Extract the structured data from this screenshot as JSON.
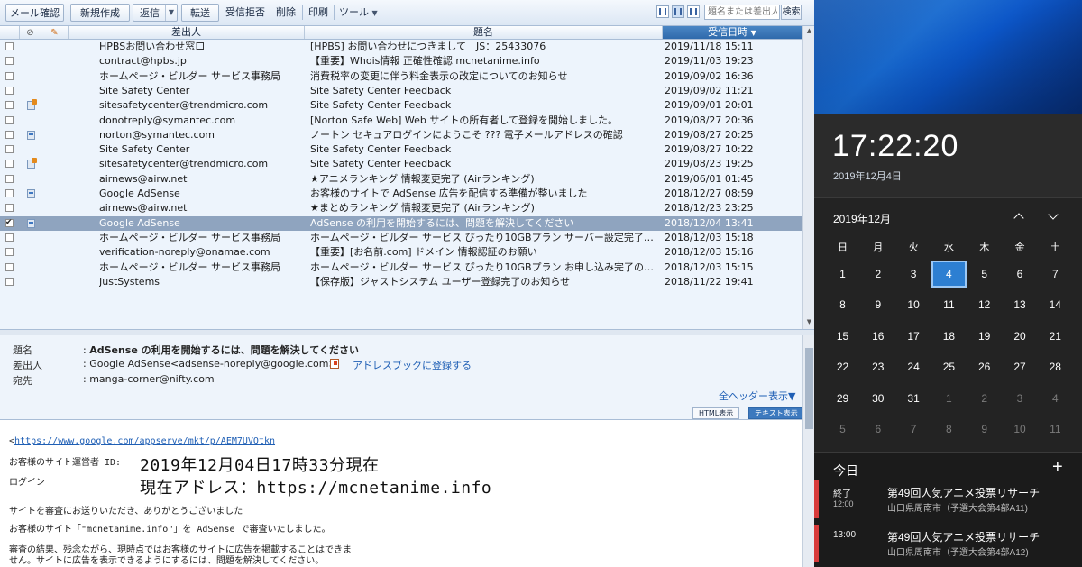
{
  "toolbar": {
    "check_mail": "メール確認",
    "new_mail": "新規作成",
    "reply": "返信",
    "forward": "転送",
    "reject": "受信拒否",
    "delete": "削除",
    "print": "印刷",
    "tools": "ツール",
    "search_placeholder": "題名または差出人",
    "search_button": "検索"
  },
  "columns": {
    "from": "差出人",
    "subject": "題名",
    "date": "受信日時"
  },
  "mails": [
    {
      "from": "HPBSお問い合わせ窓口",
      "subject": "[HPBS] お問い合わせにつきまして　JS：25433076",
      "date": "2019/11/18 15:11",
      "icon": ""
    },
    {
      "from": "contract@hpbs.jp",
      "subject": "【重要】Whois情報 正確性確認 mcnetanime.info",
      "date": "2019/11/03 19:23",
      "icon": ""
    },
    {
      "from": "ホームページ・ビルダー サービス事務局",
      "subject": "消費税率の変更に伴う料金表示の改定についてのお知らせ",
      "date": "2019/09/02 16:36",
      "icon": ""
    },
    {
      "from": "Site Safety Center",
      "subject": "Site Safety Center Feedback",
      "date": "2019/09/02 11:21",
      "icon": ""
    },
    {
      "from": "sitesafetycenter@trendmicro.com",
      "subject": "Site Safety Center Feedback",
      "date": "2019/09/01 20:01",
      "icon": "ok"
    },
    {
      "from": "donotreply@symantec.com",
      "subject": "[Norton Safe Web] Web サイトの所有者して登録を開始しました。",
      "date": "2019/08/27 20:36",
      "icon": ""
    },
    {
      "from": "norton@symantec.com",
      "subject": "ノートン セキュアログインにようこそ ??? 電子メールアドレスの確認",
      "date": "2019/08/27 20:25",
      "icon": "cert"
    },
    {
      "from": "Site Safety Center",
      "subject": "Site Safety Center Feedback",
      "date": "2019/08/27 10:22",
      "icon": ""
    },
    {
      "from": "sitesafetycenter@trendmicro.com",
      "subject": "Site Safety Center Feedback",
      "date": "2019/08/23 19:25",
      "icon": "ok"
    },
    {
      "from": "airnews@airw.net",
      "subject": "★アニメランキング 情報変更完了 (Airランキング)",
      "date": "2019/06/01 01:45",
      "icon": ""
    },
    {
      "from": "Google AdSense",
      "subject": "お客様のサイトで AdSense 広告を配信する準備が整いました",
      "date": "2018/12/27 08:59",
      "icon": "cert"
    },
    {
      "from": "airnews@airw.net",
      "subject": "★まとめランキング 情報変更完了 (Airランキング)",
      "date": "2018/12/23 23:25",
      "icon": ""
    },
    {
      "from": "Google AdSense",
      "subject": "AdSense の利用を開始するには、問題を解決してください",
      "date": "2018/12/04 13:41",
      "icon": "cert",
      "selected": true
    },
    {
      "from": "ホームページ・ビルダー サービス事務局",
      "subject": "ホームページ・ビルダー サービス ぴったり10GBプラン サーバー設定完了のお知らせ",
      "date": "2018/12/03 15:18",
      "icon": ""
    },
    {
      "from": "verification-noreply@onamae.com",
      "subject": "【重要】[お名前.com] ドメイン 情報認証のお願い",
      "date": "2018/12/03 15:16",
      "icon": ""
    },
    {
      "from": "ホームページ・ビルダー サービス事務局",
      "subject": "ホームページ・ビルダー サービス ぴったり10GBプラン お申し込み完了のお知らせ",
      "date": "2018/12/03 15:15",
      "icon": ""
    },
    {
      "from": "JustSystems",
      "subject": "【保存版】ジャストシステム ユーザー登録完了のお知らせ",
      "date": "2018/11/22 19:41",
      "icon": ""
    }
  ],
  "preview": {
    "subject_label": "題名",
    "subject": "AdSense の利用を開始するには、問題を解決してください",
    "from_label": "差出人",
    "from": "Google AdSense<adsense-noreply@google.com>",
    "add_address": "アドレスブックに登録する",
    "to_label": "宛先",
    "to": "manga-corner@nifty.com",
    "all_headers": "全ヘッダー表示▼",
    "tab_html": "HTML表示",
    "tab_text": "テキスト表示",
    "link_prefix": "<",
    "link": "https://www.google.com/appserve/mkt/p/AEM7UVQtkn",
    "line_operator": "お客様のサイト運営者 ID:",
    "line_login": "ログイン",
    "big1": "2019年12月04日17時33分現在",
    "big2": "現在アドレス：https://mcnetanime.info",
    "line1": "サイトを審査にお送りいただき、ありがとうございました",
    "line2": "お客様のサイト「\"mcnetanime.info\"」を AdSense で審査いたしました。",
    "line3": "審査の結果、残念ながら、現時点ではお客様のサイトに広告を掲載することはできま",
    "line4": "せん。サイトに広告を表示できるようにするには、問題を解決してください。"
  },
  "clock": {
    "time": "17:22:20",
    "date": "2019年12月4日"
  },
  "calendar": {
    "month": "2019年12月",
    "weekdays": [
      "日",
      "月",
      "火",
      "水",
      "木",
      "金",
      "土"
    ],
    "weeks": [
      [
        "1",
        "2",
        "3",
        "4",
        "5",
        "6",
        "7"
      ],
      [
        "8",
        "9",
        "10",
        "11",
        "12",
        "13",
        "14"
      ],
      [
        "15",
        "16",
        "17",
        "18",
        "19",
        "20",
        "21"
      ],
      [
        "22",
        "23",
        "24",
        "25",
        "26",
        "27",
        "28"
      ],
      [
        "29",
        "30",
        "31",
        "1",
        "2",
        "3",
        "4"
      ],
      [
        "5",
        "6",
        "7",
        "8",
        "9",
        "10",
        "11"
      ]
    ],
    "today": "4"
  },
  "agenda": {
    "title": "今日",
    "add": "+",
    "events": [
      {
        "time1": "終了",
        "time2": "12:00",
        "title": "第49回人気アニメ投票リサーチ",
        "location": "山口県周南市（予選大会第4部A11)"
      },
      {
        "time1": "13:00",
        "time2": "",
        "title": "第49回人気アニメ投票リサーチ",
        "location": "山口県周南市（予選大会第4部A12)"
      }
    ]
  }
}
